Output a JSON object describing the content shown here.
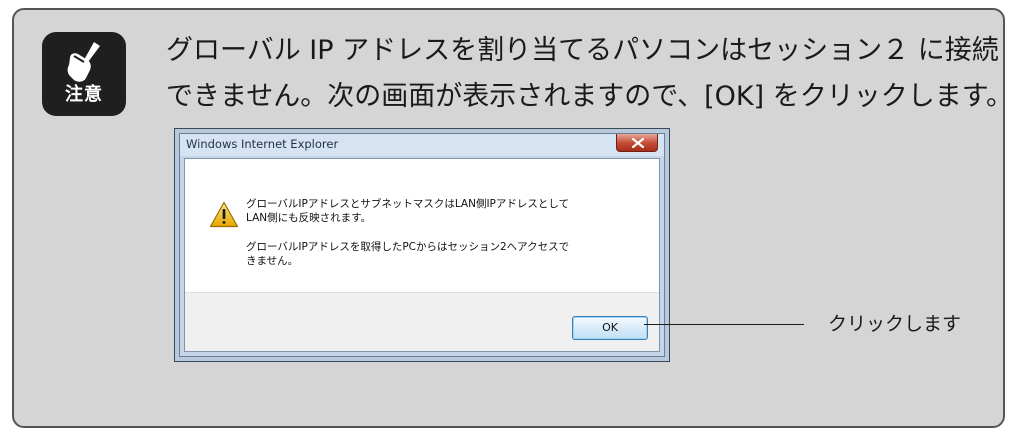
{
  "caution_badge": {
    "label": "注意",
    "icon": "pointing-hand-icon"
  },
  "note": {
    "line1": "グローバル IP アドレスを割り当てるパソコンはセッション２ に接続",
    "line2": "できません。次の画面が表示されますので、[OK] をクリックします。"
  },
  "dialog": {
    "title": "Windows Internet Explorer",
    "close_icon": "close-icon",
    "warning_icon": "warning-icon",
    "message1_line1": "グローバルIPアドレスとサブネットマスクはLAN側IPアドレスとして",
    "message1_line2": "LAN側にも反映されます。",
    "message2_line1": "グローバルIPアドレスを取得したPCからはセッション2へアクセスで",
    "message2_line2": "きません。",
    "ok_label": "OK"
  },
  "callout": {
    "text": "クリックします"
  },
  "colors": {
    "panel_bg": "#d5d5d5",
    "badge_bg": "#1f1f1f",
    "close_red": "#c44a32"
  }
}
